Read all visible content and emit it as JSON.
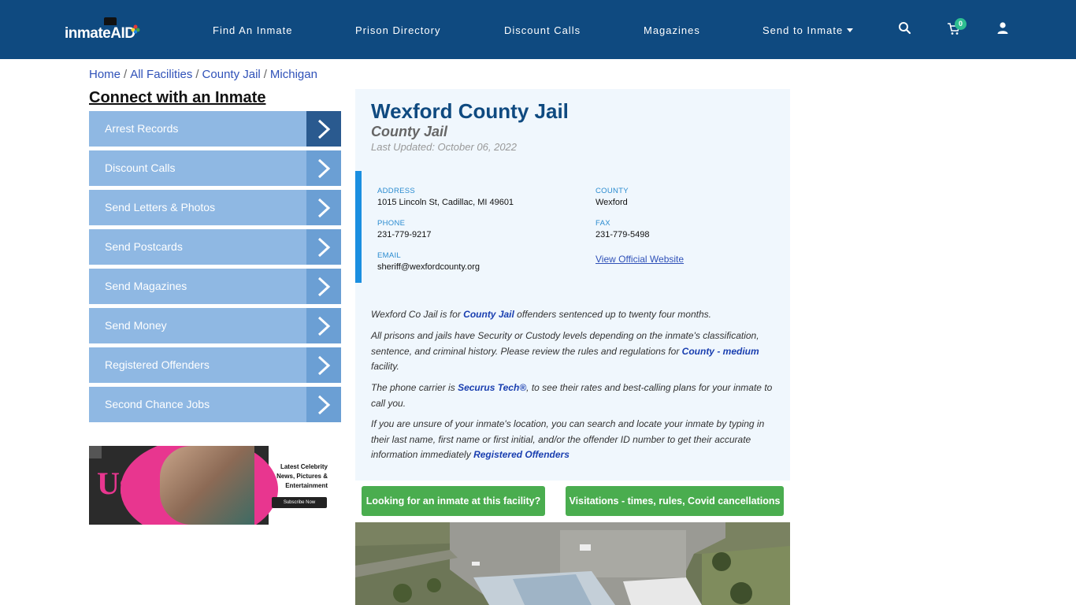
{
  "header": {
    "logo_text_inmate": "inmate",
    "logo_text_aid": "AID",
    "nav": [
      {
        "label": "Find An Inmate"
      },
      {
        "label": "Prison Directory"
      },
      {
        "label": "Discount Calls"
      },
      {
        "label": "Magazines"
      },
      {
        "label": "Send to Inmate"
      }
    ],
    "cart_count": "0",
    "icons": [
      "search-icon",
      "cart-icon",
      "user-icon"
    ]
  },
  "breadcrumb": [
    {
      "label": "Home"
    },
    {
      "label": "All Facilities"
    },
    {
      "label": "County Jail"
    },
    {
      "label": "Michigan"
    }
  ],
  "sidebar": {
    "title": "Connect with an Inmate",
    "items": [
      {
        "label": "Arrest Records"
      },
      {
        "label": "Discount Calls"
      },
      {
        "label": "Send Letters & Photos"
      },
      {
        "label": "Send Postcards"
      },
      {
        "label": "Send Magazines"
      },
      {
        "label": "Send Money"
      },
      {
        "label": "Registered Offenders"
      },
      {
        "label": "Second Chance Jobs"
      }
    ]
  },
  "ad": {
    "brand": "Us",
    "tagline": "Latest Celebrity News, Pictures & Entertainment",
    "button": "Subscribe Now"
  },
  "facility": {
    "name": "Wexford County Jail",
    "type": "County Jail",
    "updated": "Last Updated: October 06, 2022",
    "address_label": "ADDRESS",
    "address": "1015 Lincoln St, Cadillac, MI 49601",
    "county_label": "COUNTY",
    "county": "Wexford",
    "phone_label": "PHONE",
    "phone": "231-779-9217",
    "fax_label": "FAX",
    "fax": "231-779-5498",
    "email_label": "EMAIL",
    "email": "sheriff@wexfordcounty.org",
    "website_link": "View Official Website"
  },
  "description": {
    "p1_pre": "Wexford Co Jail is for ",
    "p1_link": "County Jail",
    "p1_post": " offenders sentenced up to twenty four months.",
    "p2_pre": "All prisons and jails have Security or Custody levels depending on the inmate's classification, sentence, and criminal history. Please review the rules and regulations for ",
    "p2_link": "County - medium",
    "p2_post": " facility.",
    "p3_pre": "The phone carrier is ",
    "p3_link": "Securus Tech®",
    "p3_post": ", to see their rates and best-calling plans for your inmate to call you.",
    "p4_pre": "If you are unsure of your inmate's location, you can search and locate your inmate by typing in their last name, first name or first initial, and/or the offender ID number to get their accurate information immediately ",
    "p4_link": "Registered Offenders"
  },
  "buttons": {
    "looking": "Looking for an inmate at this facility?",
    "visitations": "Visitations - times, rules, Covid cancellations"
  },
  "colors": {
    "header_bg": "#0f4a80",
    "menu_bg": "#8fb8e3",
    "menu_arrow": "#6b9fd4",
    "menu_arrow_active": "#2a5a8f",
    "panel_bg": "#f0f7fd",
    "accent_bar": "#1b8fe0",
    "green_button": "#4aad4f"
  }
}
